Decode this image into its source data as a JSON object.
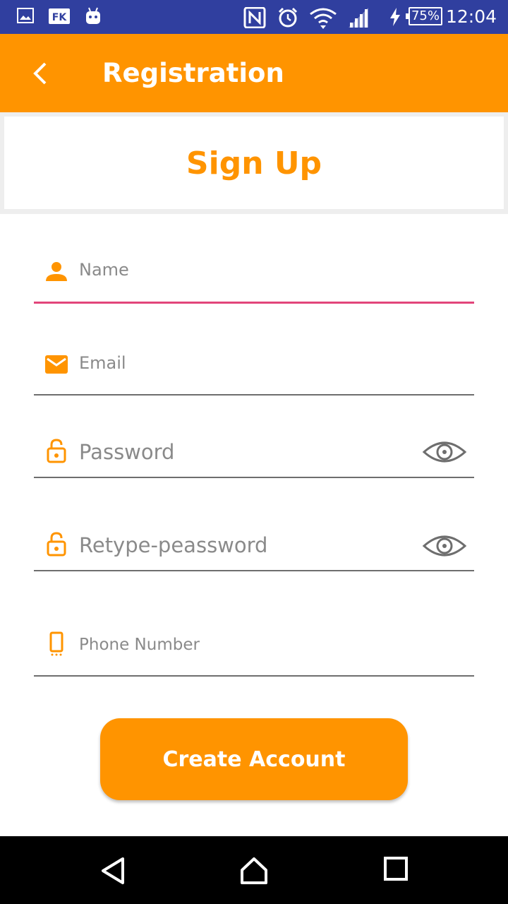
{
  "status_bar": {
    "time": "12:04",
    "battery": "75%",
    "icons": [
      "image-icon",
      "fk-app-icon",
      "android-icon",
      "nfc-icon",
      "alarm-icon",
      "wifi-icon",
      "signal-icon",
      "charging-icon"
    ]
  },
  "app_bar": {
    "title": "Registration",
    "back_icon": "chevron-left-icon"
  },
  "header": {
    "title": "Sign Up"
  },
  "form": {
    "name": {
      "placeholder": "Name",
      "value": "",
      "icon": "person-icon"
    },
    "email": {
      "placeholder": "Email",
      "value": "",
      "icon": "mail-icon"
    },
    "password": {
      "placeholder": "Password",
      "value": "",
      "icon": "lock-icon",
      "toggle_icon": "eye-icon"
    },
    "retype_password": {
      "placeholder": "Retype-peassword",
      "value": "",
      "icon": "lock-icon",
      "toggle_icon": "eye-icon"
    },
    "phone": {
      "placeholder": "Phone Number",
      "value": "",
      "icon": "phone-icon"
    }
  },
  "create_button": {
    "label": "Create Account"
  },
  "colors": {
    "status_bar": "#303f9f",
    "accent": "#ff9400",
    "active_underline": "#e2457a",
    "underline": "#6e6e6e",
    "hint_text": "#8a8a8a",
    "nav_bar": "#000000"
  },
  "nav_bar": {
    "icons": [
      "back-triangle-icon",
      "home-icon",
      "recents-icon"
    ]
  }
}
